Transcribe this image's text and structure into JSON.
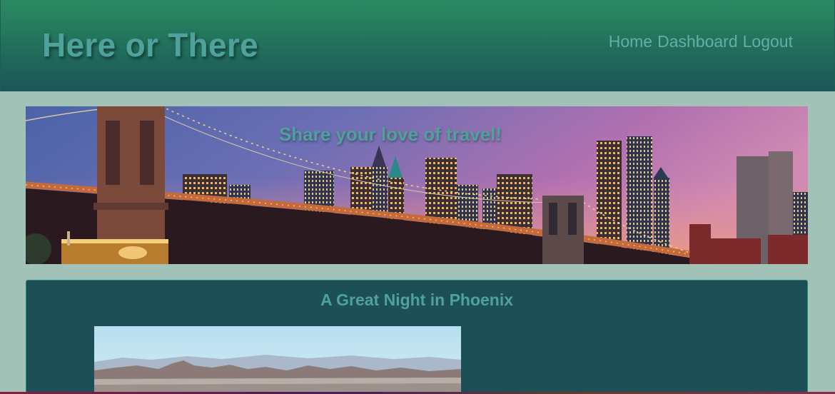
{
  "header": {
    "site_title": "Here or There",
    "nav": [
      {
        "label": "Home"
      },
      {
        "label": "Dashboard"
      },
      {
        "label": "Logout"
      }
    ]
  },
  "banner": {
    "tagline": "Share your love of travel!",
    "image": "city-skyline-bridge-night-photo"
  },
  "post": {
    "title": "A Great Night in Phoenix",
    "image": "phoenix-mountains-photo"
  },
  "colors": {
    "header_top": "#2b8a62",
    "header_bottom": "#1c5658",
    "page_background": "#a3c2b7",
    "card_background": "#1d4f57",
    "accent_text": "#4fa19b"
  }
}
